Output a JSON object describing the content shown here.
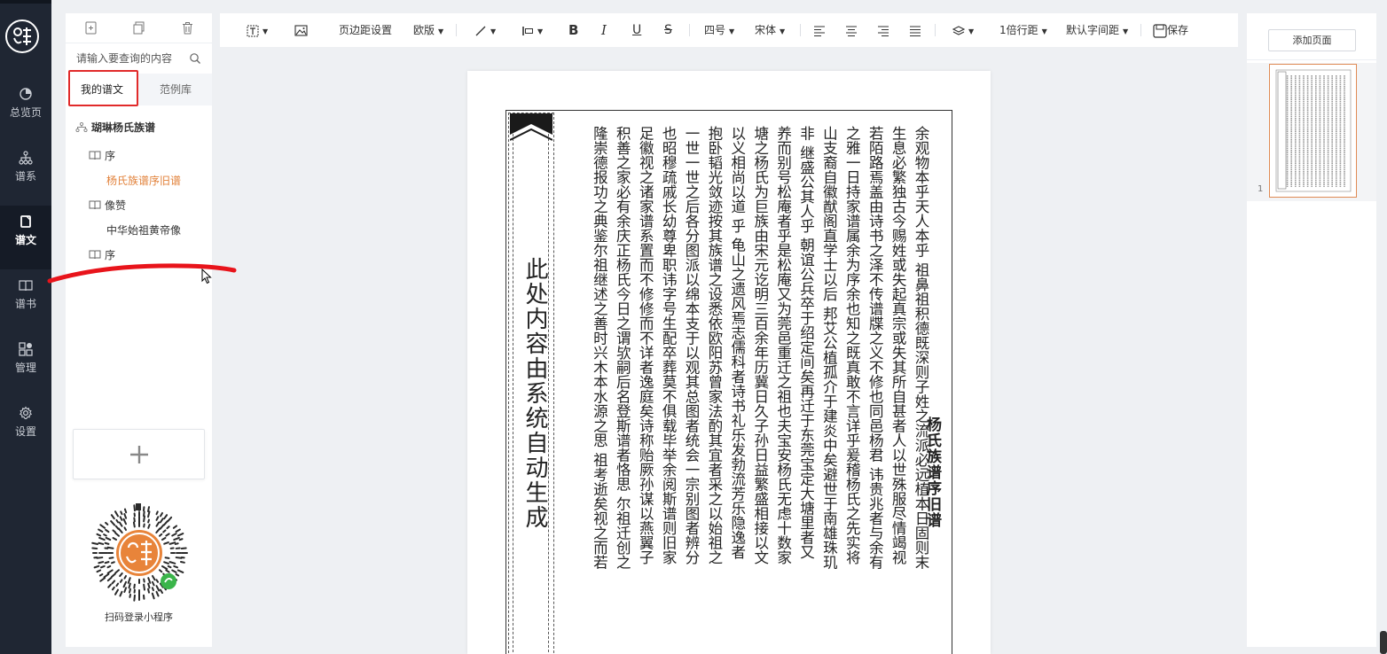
{
  "nav": {
    "items": [
      {
        "label": "总览页",
        "icon": "pie-chart-icon"
      },
      {
        "label": "谱系",
        "icon": "hierarchy-icon"
      },
      {
        "label": "谱文",
        "icon": "document-icon"
      },
      {
        "label": "谱书",
        "icon": "book-icon"
      },
      {
        "label": "管理",
        "icon": "grid-icon"
      },
      {
        "label": "设置",
        "icon": "gear-icon"
      }
    ],
    "active": "谱文"
  },
  "left_panel": {
    "tools": [
      "add-file-icon",
      "copy-icon",
      "trash-icon"
    ],
    "search": {
      "placeholder": "请输入要查询的内容"
    },
    "tabs": [
      {
        "label": "我的谱文"
      },
      {
        "label": "范例库"
      }
    ],
    "active_tab": "我的谱文",
    "tree": {
      "root": "瑚琳杨氏族谱",
      "items": [
        {
          "label": "序",
          "children": [
            {
              "label": "杨氏族谱序旧谱",
              "selected": true
            }
          ]
        },
        {
          "label": "像赞",
          "children": [
            {
              "label": "中华始祖黄帝像"
            }
          ]
        },
        {
          "label": "序",
          "children": []
        }
      ]
    },
    "qr_caption": "扫码登录小程序"
  },
  "toolbar": {
    "page_margin": "页边距设置",
    "layout": "欧版",
    "bold": "B",
    "italic": "I",
    "underline": "U",
    "strike": "S",
    "font_size": "四号",
    "font": "宋体",
    "line_spacing": "1倍行距",
    "letter_spacing": "默认字间距",
    "save": "保存"
  },
  "document": {
    "banner": "此处内容由系统自动生成",
    "title": "杨氏族谱序旧谱",
    "columns": [
      "余观物本乎天人本乎 祖鼻祖积德既深则子姓之流派必远植本日固则末",
      "生息必繁独古今赐姓或失起真宗或失其所自甚者人以世殊服尽情竭视",
      "若陌路焉盖由诗书之泽不传谱牒之义不修也同邑杨君 讳贵兆者与余有",
      "之雅一日持家谱属余为序余也知之既真敢不言详乎爰稽杨氏之先实将",
      "山支裔自徽猷阁直学士以后 邦艾公植孤介于建炎中矣避世于南雄珠玑",
      "非 继盛公其人乎 朝谊公兵卒于绍定间矣再迁于东莞宝定大塘里者又",
      "养而别号松庵者乎是松庵又为莞邑重迁之祖也夫宝安杨氏无虑十数家",
      "塘之杨氏为巨族由宋元讫明三百余年历冀日久子孙日益繁盛相接以文",
      "以义相尚以道 乎 龟山之遗风焉志儒科者诗书礼乐发勃流芳乐隐逸者",
      "抱卧韬光敛迹按其族谱之设悉依欧阳苏曾家法酌其宜者采之以始祖之",
      "一世一世之后各分图派以绵本支于以观其总图者统会一宗别图者辨分",
      "也昭穆疏戚长幼尊卑职讳字号生配卒葬莫不俱载毕举余阅斯谱则旧家",
      "足徽视之诸家谱系置而不修修而不详者逸庭矣诗称贻厥孙谋以燕翼子",
      "积善之家必有余庆正杨氏今日之谓欤嗣后名登斯谱者恪思 尔祖迁创之",
      "隆崇德报功之典鉴尔祖继述之善时兴木本水源之思 祖考逝矣视之而若"
    ]
  },
  "right_panel": {
    "add_page": "添加页面",
    "thumb_page": "1"
  }
}
